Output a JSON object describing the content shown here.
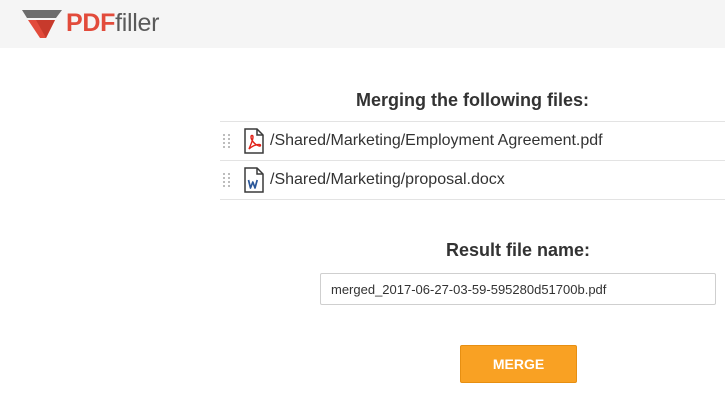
{
  "header": {
    "logo_pdf": "PDF",
    "logo_filler": "filler"
  },
  "merge": {
    "title": "Merging the following files:",
    "files": [
      {
        "path": "/Shared/Marketing/Employment Agreement.pdf",
        "icon": "pdf-file-icon"
      },
      {
        "path": "/Shared/Marketing/proposal.docx",
        "icon": "word-file-icon"
      }
    ]
  },
  "result": {
    "title": "Result file name:",
    "filename": "merged_2017-06-27-03-59-595280d51700b.pdf"
  },
  "actions": {
    "merge_label": "MERGE"
  },
  "colors": {
    "brand_red": "#e24b3b",
    "button_orange": "#f9a123"
  }
}
